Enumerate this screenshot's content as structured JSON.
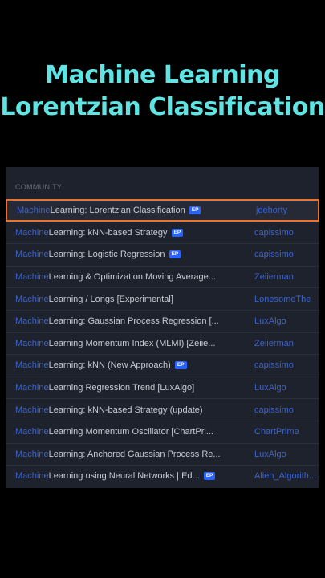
{
  "headline": {
    "line1": "Machine Learning",
    "line2": "Lorentzian Classification"
  },
  "section": {
    "label": "COMMUNITY"
  },
  "rows": [
    {
      "kw": "Machine",
      "rest": " Learning: Lorentzian Classification",
      "badge": "EP",
      "author": "jdehorty",
      "selected": true
    },
    {
      "kw": "Machine",
      "rest": " Learning: kNN-based Strategy",
      "badge": "EP",
      "author": "capissimo"
    },
    {
      "kw": "Machine",
      "rest": " Learning: Logistic Regression",
      "badge": "EP",
      "author": "capissimo"
    },
    {
      "kw": "Machine",
      "rest": " Learning & Optimization Moving Average...",
      "badge": "",
      "author": "Zeiierman"
    },
    {
      "kw": "Machine",
      "rest": " Learning / Longs [Experimental]",
      "badge": "",
      "author": "LonesomeThe"
    },
    {
      "kw": "Machine",
      "rest": " Learning: Gaussian Process Regression [...",
      "badge": "",
      "author": "LuxAlgo"
    },
    {
      "kw": "Machine",
      "rest": " Learning Momentum Index (MLMI) [Zeiie...",
      "badge": "",
      "author": "Zeiierman"
    },
    {
      "kw": "Machine",
      "rest": " Learning: kNN (New Approach)",
      "badge": "EP",
      "author": "capissimo"
    },
    {
      "kw": "Machine",
      "rest": " Learning Regression Trend [LuxAlgo]",
      "badge": "",
      "author": "LuxAlgo"
    },
    {
      "kw": "Machine",
      "rest": " Learning: kNN-based Strategy (update)",
      "badge": "",
      "author": "capissimo"
    },
    {
      "kw": "Machine",
      "rest": " Learning Momentum Oscillator [ChartPri...",
      "badge": "",
      "author": "ChartPrime"
    },
    {
      "kw": "Machine",
      "rest": " Learning: Anchored Gaussian Process Re...",
      "badge": "",
      "author": "LuxAlgo"
    },
    {
      "kw": "Machine",
      "rest": " Learning using Neural Networks | Ed...",
      "badge": "EP",
      "author": "Alien_Algorith..."
    }
  ]
}
